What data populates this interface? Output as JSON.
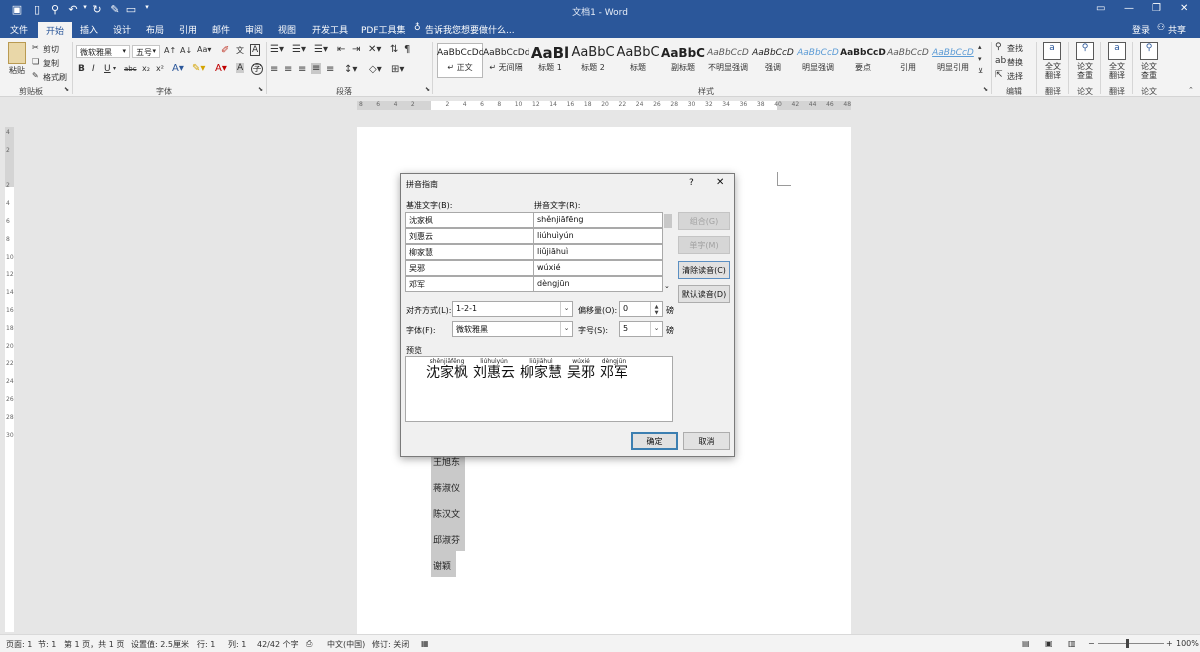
{
  "window": {
    "title": "文档1 - Word"
  },
  "tabs": [
    "文件",
    "开始",
    "插入",
    "设计",
    "布局",
    "引用",
    "邮件",
    "审阅",
    "视图",
    "开发工具",
    "PDF工具集"
  ],
  "tell_me": "告诉我您想要做什么...",
  "account": {
    "login": "登录",
    "share": "共享"
  },
  "clipboard": {
    "paste": "粘贴",
    "cut": "剪切",
    "copy": "复制",
    "format_painter": "格式刷",
    "group": "剪贴板"
  },
  "font": {
    "name": "微软雅黑",
    "size": "五号",
    "group": "字体"
  },
  "paragraph": {
    "group": "段落"
  },
  "styles": {
    "group": "样式",
    "items": [
      {
        "preview": "AaBbCcDd",
        "name": "↵ 正文"
      },
      {
        "preview": "AaBbCcDd",
        "name": "↵ 无间隔"
      },
      {
        "preview": "AaBl",
        "name": "标题 1"
      },
      {
        "preview": "AaBbC",
        "name": "标题 2"
      },
      {
        "preview": "AaBbC",
        "name": "标题"
      },
      {
        "preview": "AaBbC",
        "name": "副标题"
      },
      {
        "preview": "AaBbCcD",
        "name": "不明显强调"
      },
      {
        "preview": "AaBbCcD",
        "name": "强调"
      },
      {
        "preview": "AaBbCcD",
        "name": "明显强调"
      },
      {
        "preview": "AaBbCcD",
        "name": "要点"
      },
      {
        "preview": "AaBbCcD",
        "name": "引用"
      },
      {
        "preview": "AaBbCcD",
        "name": "明显引用"
      }
    ]
  },
  "editing": {
    "find": "查找",
    "replace": "替换",
    "select": "选择",
    "group": "编辑"
  },
  "extra_groups": [
    {
      "label": "全文\n翻译",
      "group": "翻译"
    },
    {
      "label": "论文\n查重",
      "group": "论文"
    },
    {
      "label": "全文\n翻译",
      "group": "翻译"
    },
    {
      "label": "论文\n查重",
      "group": "论文"
    }
  ],
  "ruler_h": [
    "8",
    "6",
    "4",
    "2",
    "",
    "2",
    "4",
    "6",
    "8",
    "10",
    "12",
    "14",
    "16",
    "18",
    "20",
    "22",
    "24",
    "26",
    "28",
    "30",
    "32",
    "34",
    "36",
    "38",
    "40",
    "42",
    "44",
    "46",
    "48"
  ],
  "ruler_v": [
    "4",
    "2",
    "",
    "2",
    "4",
    "6",
    "8",
    "10",
    "12",
    "14",
    "16",
    "18",
    "20",
    "22",
    "24",
    "26",
    "28",
    "30"
  ],
  "document_names": [
    "王旭东",
    "蒋淑仪",
    "陈汉文",
    "邱淑芬",
    "谢颖"
  ],
  "dialog": {
    "title": "拼音指南",
    "help": "?",
    "close": "✕",
    "base_label": "基准文字(B):",
    "ruby_label": "拼音文字(R):",
    "rows": [
      {
        "base": "沈家枫",
        "ruby": "shěnjiāfēng"
      },
      {
        "base": "刘惠云",
        "ruby": "liúhuìyún"
      },
      {
        "base": "柳家慧",
        "ruby": "liǔjiāhuì"
      },
      {
        "base": "吴邪",
        "ruby": "wúxié"
      },
      {
        "base": "邓军",
        "ruby": "dèngjūn"
      }
    ],
    "buttons": {
      "combine": "组合(G)",
      "single": "单字(M)",
      "clear": "清除读音(C)",
      "default": "默认读音(D)"
    },
    "align_label": "对齐方式(L):",
    "align_value": "1-2-1",
    "offset_label": "偏移量(O):",
    "offset_value": "0",
    "font_label": "字体(F):",
    "font_value": "微软雅黑",
    "size_label": "字号(S):",
    "size_value": "5",
    "unit": "磅",
    "preview_label": "预览",
    "ok": "确定",
    "cancel": "取消"
  },
  "status": {
    "page": "页面: 1",
    "section": "节: 1",
    "page_of": "第 1 页，共 1 页",
    "position": "设置值: 2.5厘米",
    "row": "行: 1",
    "col": "列: 1",
    "words": "42/42 个字",
    "lang": "中文(中国)",
    "track": "修订: 关闭",
    "zoom": "100%"
  }
}
